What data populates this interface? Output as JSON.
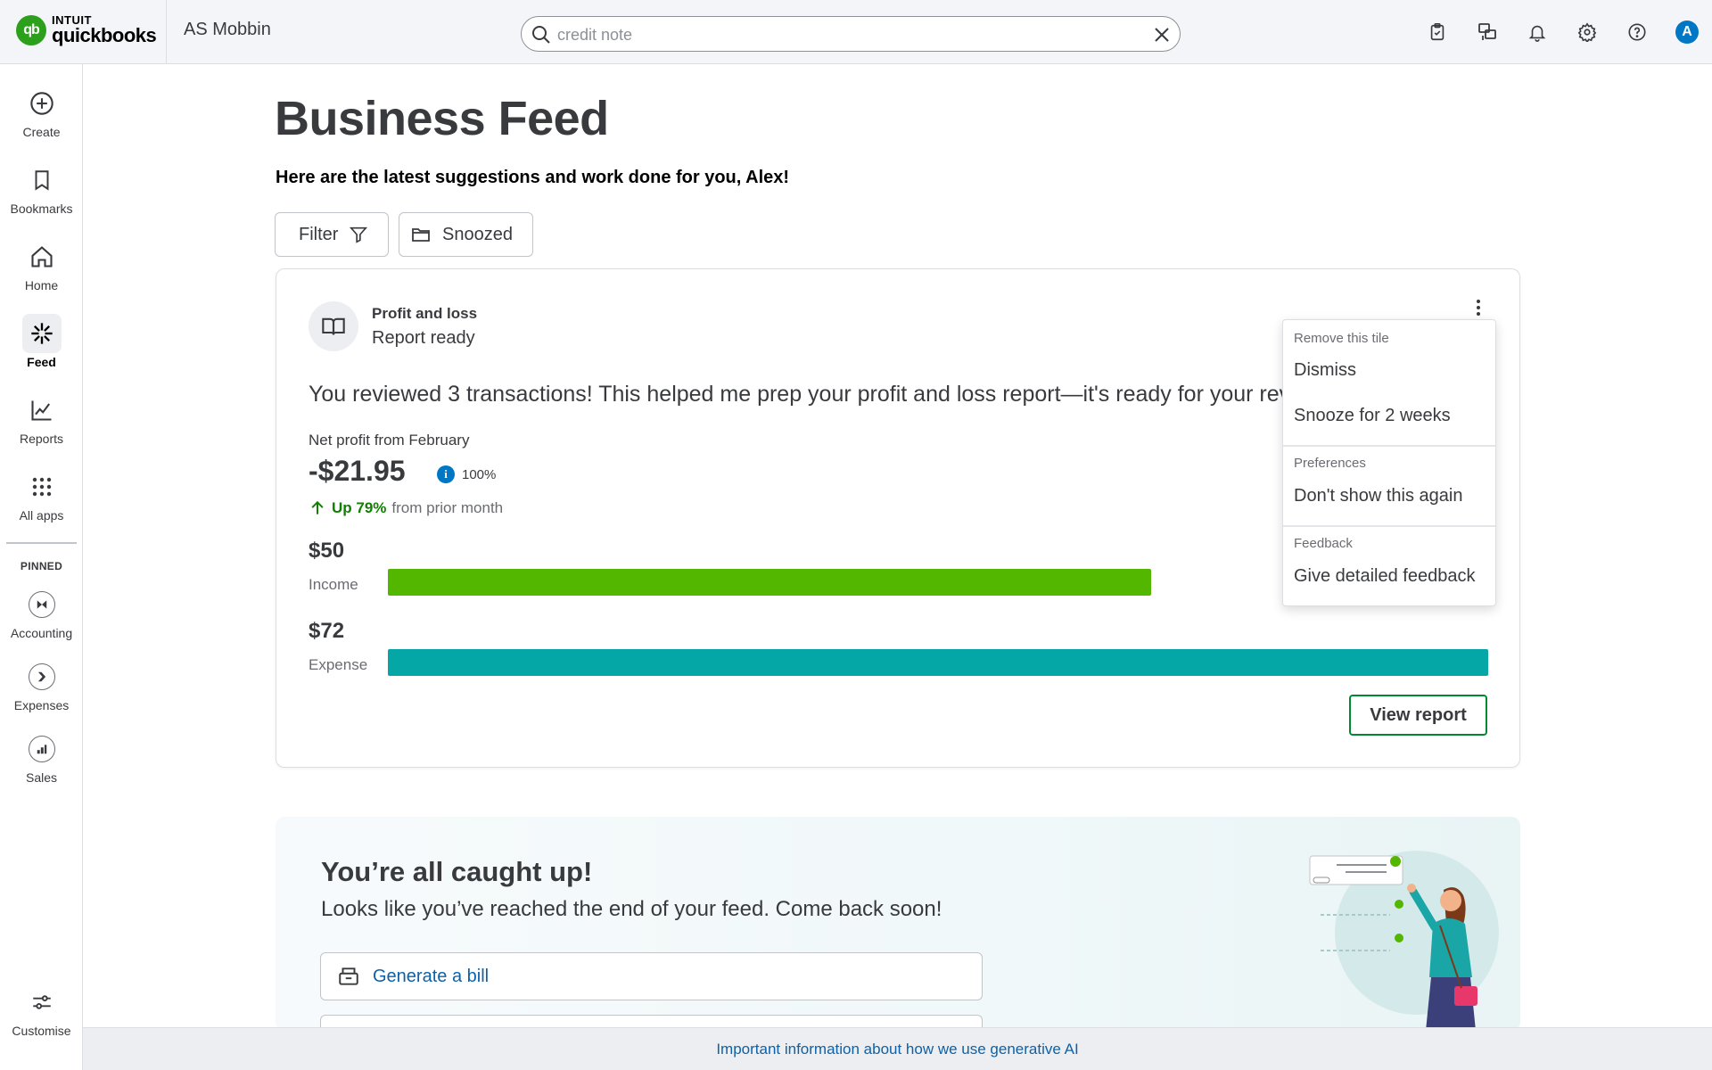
{
  "app": {
    "logo_intuit": "INTUIT",
    "logo_product": "quickbooks",
    "company_name": "AS Mobbin"
  },
  "search": {
    "value": "credit note"
  },
  "topbar": {
    "icons": [
      "clipboard-check-icon",
      "apps-switch-icon",
      "bell-icon",
      "gear-icon",
      "help-icon"
    ],
    "avatar_initial": "A"
  },
  "sidebar": {
    "items": [
      {
        "label": "Create",
        "icon": "plus-circle-icon"
      },
      {
        "label": "Bookmarks",
        "icon": "bookmark-icon"
      },
      {
        "label": "Home",
        "icon": "home-icon"
      },
      {
        "label": "Feed",
        "icon": "sparkle-icon",
        "active": true
      },
      {
        "label": "Reports",
        "icon": "line-chart-icon"
      },
      {
        "label": "All apps",
        "icon": "grid-dots-icon"
      }
    ],
    "pinned_label": "PINNED",
    "pinned": [
      {
        "label": "Accounting",
        "icon": "accounting-icon"
      },
      {
        "label": "Expenses",
        "icon": "expenses-icon"
      },
      {
        "label": "Sales",
        "icon": "sales-icon"
      }
    ],
    "customise_label": "Customise"
  },
  "main": {
    "title": "Business Feed",
    "subtitle": "Here are the latest suggestions and work done for you, Alex!",
    "filter_label": "Filter",
    "snoozed_label": "Snoozed"
  },
  "card": {
    "title": "Profit and loss",
    "subtitle": "Report ready",
    "message": "You reviewed 3 transactions! This helped me prep your profit and loss report—it's ready for your review.",
    "net_profit_label": "Net profit from February",
    "net_profit_value": "-$21.95",
    "confidence": "100%",
    "trend_up": "Up 79%",
    "trend_rest": "from prior month",
    "income_amount": "$50",
    "income_label": "Income",
    "income_fraction": 0.694,
    "expense_amount": "$72",
    "expense_label": "Expense",
    "expense_fraction": 1.0,
    "income_color": "#53b700",
    "expense_color": "#05a6a6",
    "view_report_label": "View report"
  },
  "menu": {
    "section_remove": "Remove this tile",
    "dismiss": "Dismiss",
    "snooze": "Snooze for 2 weeks",
    "section_preferences": "Preferences",
    "dont_show": "Don't show this again",
    "section_feedback": "Feedback",
    "give_feedback": "Give detailed feedback"
  },
  "caught_up": {
    "title": "You’re all caught up!",
    "subtitle": "Looks like you’ve reached the end of your feed. Come back soon!",
    "action_label": "Generate a bill"
  },
  "footer": {
    "link": "Important information about how we use generative AI"
  }
}
